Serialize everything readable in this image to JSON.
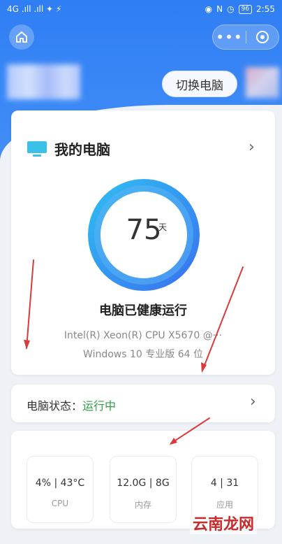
{
  "status_bar": {
    "left_text": "4G .ıll .ıll ✦ ⚡",
    "battery": "96",
    "time": "2:55"
  },
  "header": {
    "switch_button_label": "切换电脑"
  },
  "my_computer": {
    "title": "我的电脑",
    "days_value": "75",
    "days_unit": "天",
    "health_status": "电脑已健康运行",
    "cpu_model": "Intel(R) Xeon(R) CPU X5670 @···",
    "os_info": "Windows 10 专业版 64 位"
  },
  "computer_status": {
    "label": "电脑状态：",
    "value": "运行中"
  },
  "stats": [
    {
      "value": "4% | 43°C",
      "label": "CPU"
    },
    {
      "value": "12.0G | 8G",
      "label": "内存"
    },
    {
      "value": "4 | 31",
      "label": "应用"
    }
  ],
  "watermark": "云南龙网",
  "colors": {
    "header_blue": "#2f7ef3",
    "ring_blue": "#29a4ef",
    "running_green": "#2ea043",
    "annotation_red": "#d93a3a"
  }
}
